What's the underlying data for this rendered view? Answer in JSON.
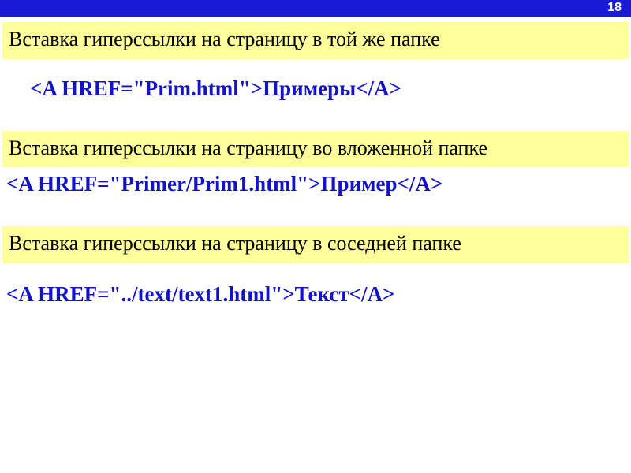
{
  "slide": {
    "page_number": "18"
  },
  "sections": [
    {
      "heading": "Вставка гиперссылки на страницу в той же папке",
      "code": "<A HREF=\"Prim.html\">Примеры</A>"
    },
    {
      "heading": "Вставка гиперссылки на страницу во вложенной папке",
      "code": "<A HREF=\"Primer/Prim1.html\">Пример</A>"
    },
    {
      "heading": "Вставка гиперссылки на страницу в соседней папке",
      "code": "<A HREF=\"../text/text1.html\">Текст</A>"
    }
  ]
}
